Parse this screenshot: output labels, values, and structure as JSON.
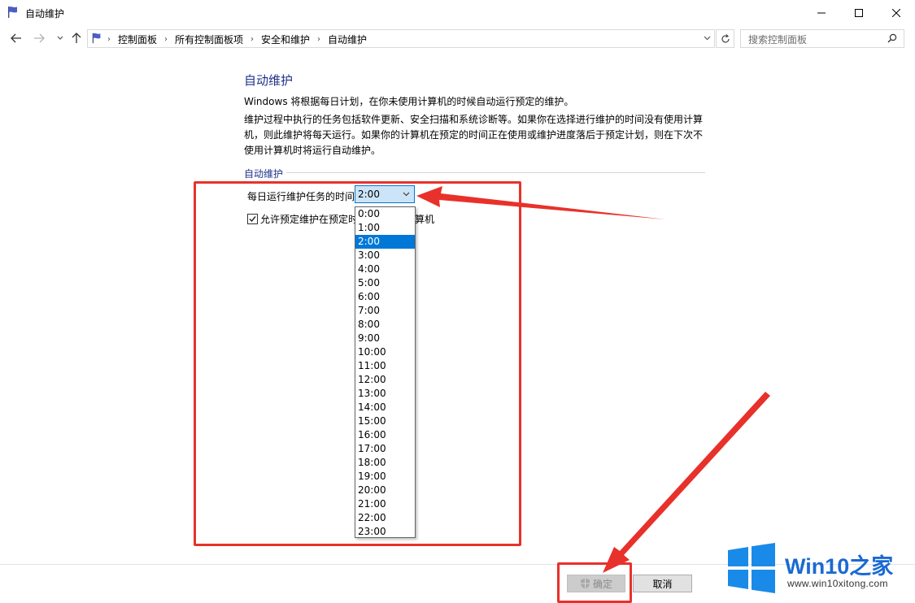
{
  "window": {
    "title": "自动维护",
    "colors": {
      "accent": "#0078d7",
      "title_blue": "#1e3287",
      "annotation_red": "#e8312a"
    }
  },
  "titlebar_icons": {
    "app": "control-panel-flag-icon",
    "minimize": "minimize-icon",
    "maximize": "maximize-icon",
    "close": "close-icon"
  },
  "nav": {
    "breadcrumbs": [
      "控制面板",
      "所有控制面板项",
      "安全和维护",
      "自动维护"
    ],
    "search_placeholder": "搜索控制面板"
  },
  "main": {
    "title": "自动维护",
    "description": "Windows 将根据每日计划，在你未使用计算机的时候自动运行预定的维护。",
    "details": "维护过程中执行的任务包括软件更新、安全扫描和系统诊断等。如果你在选择进行维护的时间没有使用计算机，则此维护将每天运行。如果你的计算机在预定的时间正在使用或维护进度落后于预定计划，则在下次不使用计算机时将运行自动维护。",
    "group_label": "自动维护",
    "time_label": "每日运行维护任务的时间",
    "selected_time": "2:00",
    "checkbox": {
      "label_start": "允许预定维护在预定时",
      "label_end": "算机",
      "checked": true
    },
    "time_options": [
      "0:00",
      "1:00",
      "2:00",
      "3:00",
      "4:00",
      "5:00",
      "6:00",
      "7:00",
      "8:00",
      "9:00",
      "10:00",
      "11:00",
      "12:00",
      "13:00",
      "14:00",
      "15:00",
      "16:00",
      "17:00",
      "18:00",
      "19:00",
      "20:00",
      "21:00",
      "22:00",
      "23:00"
    ]
  },
  "buttons": {
    "ok": "确定",
    "cancel": "取消"
  },
  "watermark": {
    "brand": "Win10之家",
    "url": "www.win10xitong.com"
  }
}
